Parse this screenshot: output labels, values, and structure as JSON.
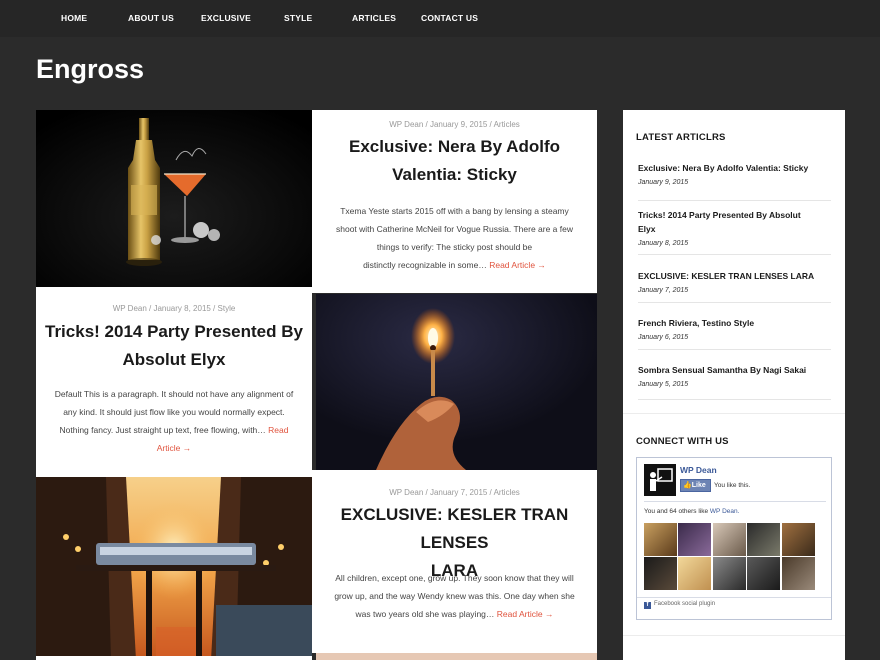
{
  "nav": {
    "items": [
      "HOME",
      "ABOUT US",
      "EXCLUSIVE",
      "STYLE",
      "ARTICLES",
      "CONTACT US"
    ]
  },
  "site": {
    "title": "Engross"
  },
  "posts": [
    {
      "meta": "WP Dean / January 9, 2015 / Articles",
      "title_line1": "Exclusive: Nera By Adolfo",
      "title_line2": "Valentia: Sticky",
      "excerpt_line1": "Txema Yeste starts 2015 off with a bang by lensing a steamy",
      "excerpt_line2": "shoot with Catherine McNeil for Vogue Russia. There are a few",
      "excerpt_line3": "things to verify: The sticky post should be",
      "excerpt_line4": "distinctly recognizable in some…",
      "readmore": "Read Article →"
    },
    {
      "meta": "WP Dean / January 8, 2015 / Style",
      "title_line1": "Tricks! 2014 Party Presented By",
      "title_line2": "Absolut Elyx",
      "excerpt_line1": "Default This is a paragraph. It should not have any alignment of",
      "excerpt_line2": "any kind. It should just flow like you would normally expect.",
      "excerpt_line3": "Nothing fancy. Just straight up text, free flowing, with…",
      "readmore_a": "Read",
      "readmore_b": "Article →"
    },
    {
      "meta": "WP Dean / January 7, 2015 / Articles",
      "title_line1": "EXCLUSIVE: KESLER TRAN LENSES",
      "title_line2": "LARA",
      "excerpt_line1": "All children, except one, grow up. They soon know that they will",
      "excerpt_line2": "grow up, and the way Wendy knew was this. One day when she",
      "excerpt_line3": "was two years old she was playing…",
      "readmore": "Read Article →"
    }
  ],
  "sidebar": {
    "latest_title": "LATEST ARTICLRS",
    "latest": [
      {
        "title_a": "Exclusive: Nera By Adolfo Valentia: Sticky",
        "title_b": "",
        "date": "January 9, 2015"
      },
      {
        "title_a": "Tricks! 2014 Party Presented By Absolut",
        "title_b": "Elyx",
        "date": "January 8, 2015"
      },
      {
        "title_a": "EXCLUSIVE: KESLER TRAN LENSES LARA",
        "title_b": "",
        "date": "January 7, 2015"
      },
      {
        "title_a": "French Riviera, Testino Style",
        "title_b": "",
        "date": "January 6, 2015"
      },
      {
        "title_a": "Sombra Sensual Samantha By Nagi Sakai",
        "title_b": "",
        "date": "January 5, 2015"
      }
    ],
    "connect_title": "CONNECT WITH US",
    "facebook": {
      "page_name": "WP Dean",
      "like_label": "Like",
      "you_like": "You like this.",
      "others_a": "You and 64 others like ",
      "others_link": "WP Dean.",
      "plugin_label": "Facebook social plugin",
      "fb_glyph": "f"
    }
  },
  "colors": {
    "background": "#2b2b2b",
    "nav": "#262626",
    "accent": "#e0533d",
    "facebook": "#3b5998"
  },
  "icons": [
    "facebook-icon",
    "like-thumb-icon"
  ]
}
